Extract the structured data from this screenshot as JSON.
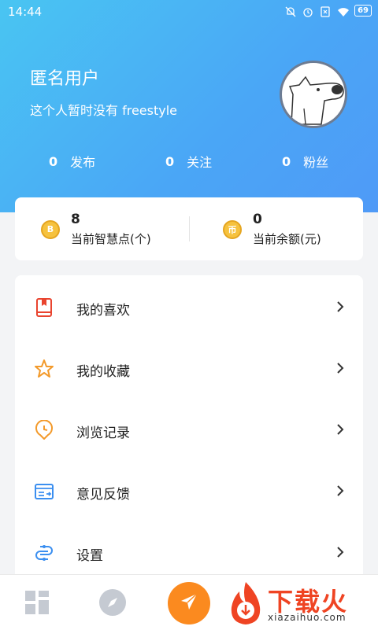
{
  "status_bar": {
    "time": "14:44",
    "battery": "69",
    "icons": [
      "mute-bell-icon",
      "alarm-icon",
      "sim-icon",
      "wifi-icon",
      "battery-icon"
    ]
  },
  "profile": {
    "name": "匿名用户",
    "bio": "这个人暂时没有 freestyle"
  },
  "stats": [
    {
      "value": "0",
      "label": "发布"
    },
    {
      "value": "0",
      "label": "关注"
    },
    {
      "value": "0",
      "label": "粉丝"
    }
  ],
  "wallet": [
    {
      "value": "8",
      "label": "当前智慧点(个)",
      "coin_symbol": "B"
    },
    {
      "value": "0",
      "label": "当前余额(元)",
      "coin_symbol": "币"
    }
  ],
  "menu": [
    {
      "label": "我的喜欢",
      "icon": "book-icon",
      "color": "#e9442f"
    },
    {
      "label": "我的收藏",
      "icon": "star-icon",
      "color": "#f39a2b"
    },
    {
      "label": "浏览记录",
      "icon": "clock-pin-icon",
      "color": "#f39a2b"
    },
    {
      "label": "意见反馈",
      "icon": "feedback-icon",
      "color": "#3b8ff0"
    },
    {
      "label": "设置",
      "icon": "settings-icon",
      "color": "#3b8ff0"
    }
  ],
  "tabbar": {
    "items": [
      "grid-icon",
      "compass-icon",
      "send-icon"
    ]
  },
  "logo": {
    "text": "下载火",
    "url": "xiazaihuo.com"
  },
  "colors": {
    "header_start": "#49c5f2",
    "header_end": "#4f9af7",
    "accent": "#fb8a1f",
    "background": "#f3f4f6"
  }
}
